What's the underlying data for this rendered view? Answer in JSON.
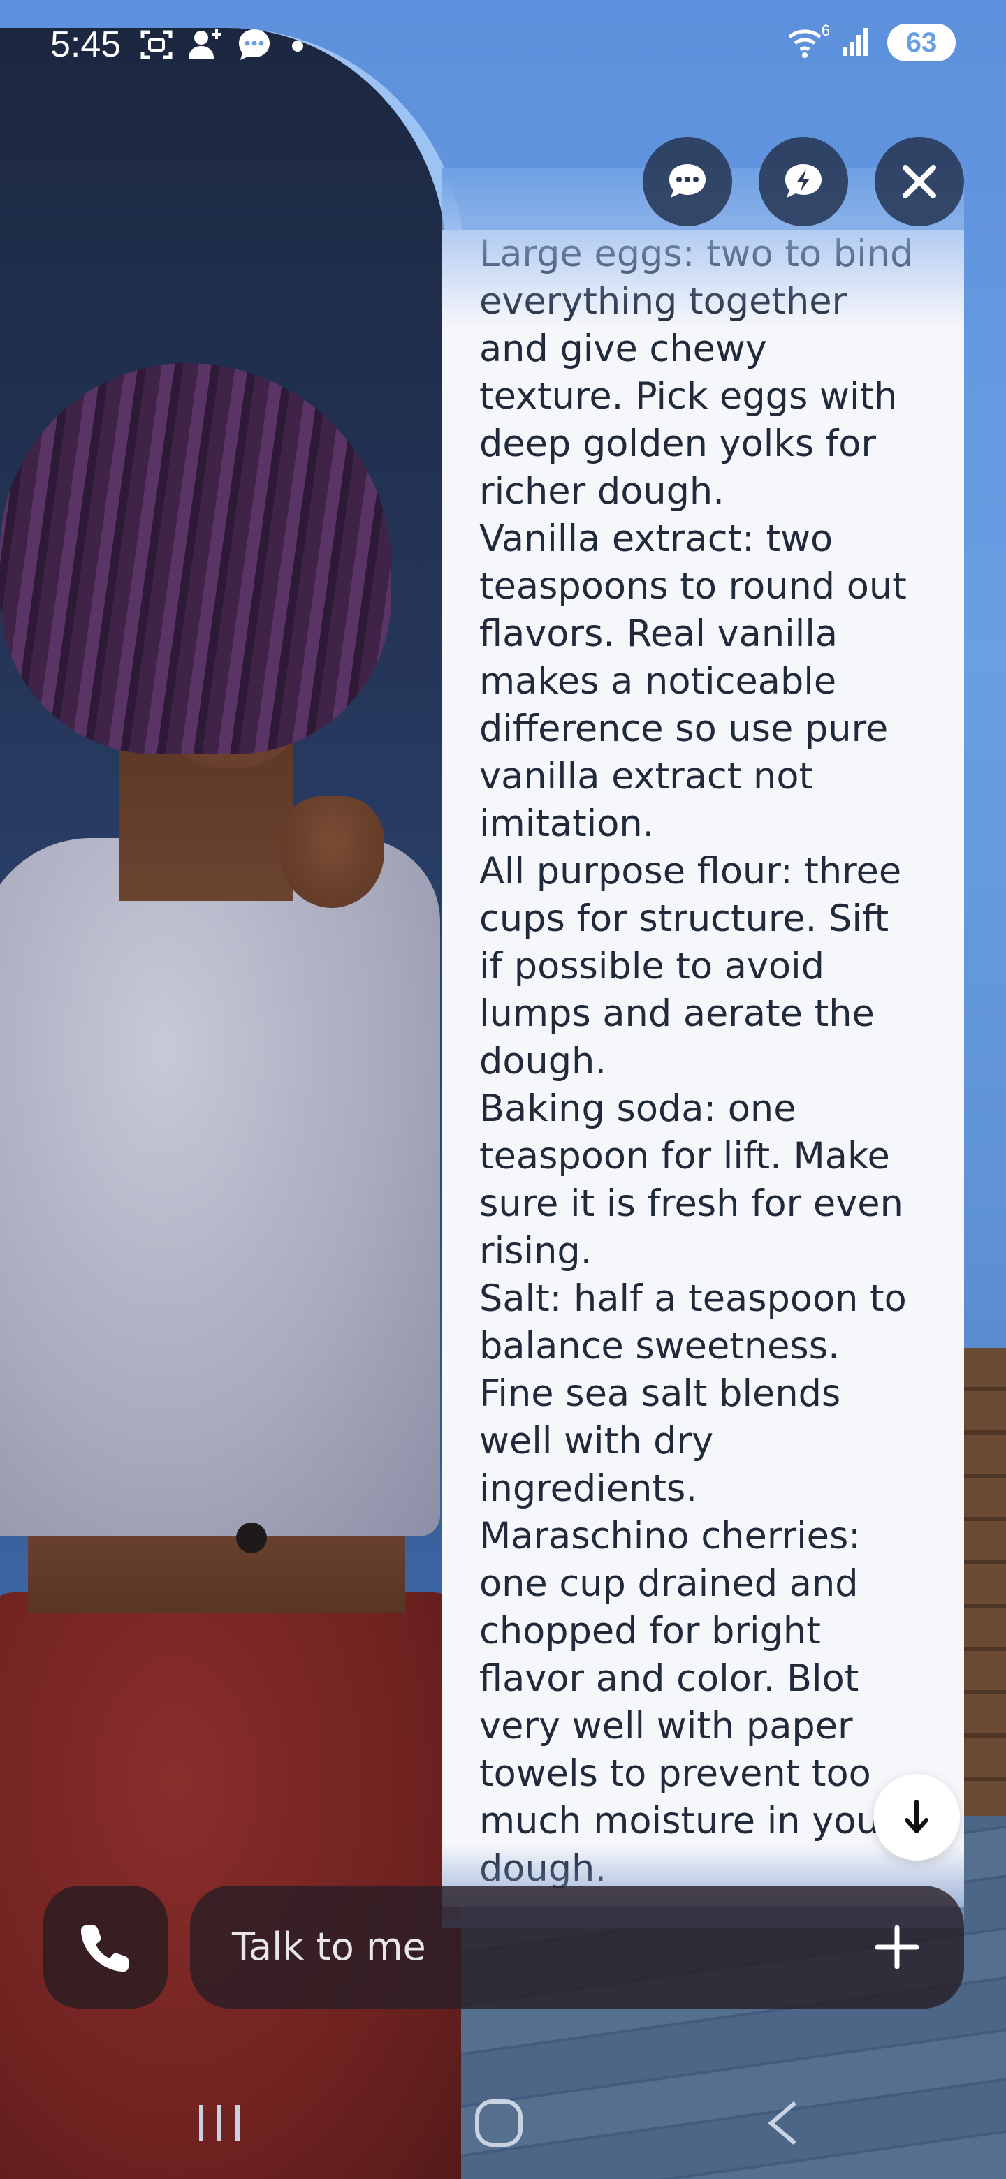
{
  "status_bar": {
    "time": "5:45",
    "icons": [
      "screenshot-icon",
      "person-add-icon",
      "chat-bubble-icon"
    ],
    "wifi_label": "6",
    "battery": "63"
  },
  "top_actions": [
    "chat-icon",
    "lightning-chat-icon",
    "close-icon"
  ],
  "message": {
    "lines": [
      "Large eggs: two to bind",
      "everything together",
      "and give chewy",
      "texture. Pick eggs with",
      "deep golden yolks for",
      "richer dough.",
      "Vanilla extract: two",
      "teaspoons to round out",
      "flavors. Real vanilla",
      "makes a noticeable",
      "difference so use pure",
      "vanilla extract not",
      "imitation.",
      "All purpose flour: three",
      "cups for structure. Sift",
      "if possible to avoid",
      "lumps and aerate the",
      "dough.",
      "Baking soda: one",
      "teaspoon for lift. Make",
      "sure it is fresh for even",
      "rising.",
      "Salt: half a teaspoon to",
      "balance sweetness.",
      "Fine sea salt blends",
      "well with dry",
      "ingredients.",
      "Maraschino cherries:",
      "one cup drained and",
      "chopped for bright",
      "flavor and color. Blot",
      "very well with paper",
      "towels to prevent too",
      "much moisture in your",
      "dough."
    ]
  },
  "input": {
    "placeholder": "Talk to me"
  },
  "colors": {
    "panel_bg": "#f6f7fb",
    "text": "#202a3a",
    "button_dark": "#283856"
  }
}
